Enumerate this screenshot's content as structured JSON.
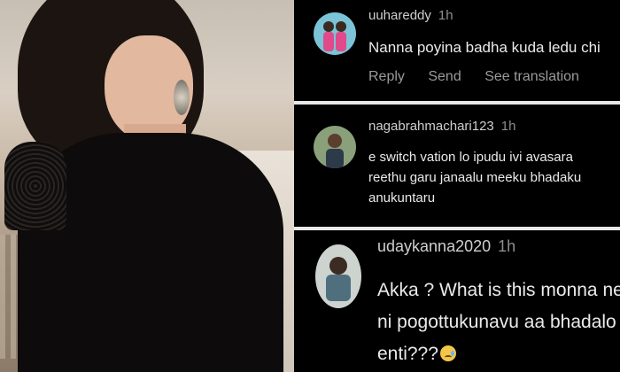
{
  "photo": {
    "alt_subject": "woman-in-black-saree-photo"
  },
  "comments": [
    {
      "username": "uuhareddy",
      "time": "1h",
      "lines": [
        "Nanna poyina badha kuda ledu chi"
      ],
      "actions": {
        "reply": "Reply",
        "send": "Send",
        "translate": "See translation"
      }
    },
    {
      "username": "nagabrahmachari123",
      "time": "1h",
      "lines": [
        "e switch vation lo ipudu ivi avasara",
        "reethu garu janaalu meeku bhadaku",
        "anukuntaru"
      ]
    },
    {
      "username": "udaykanna2020",
      "time": "1h",
      "lines": [
        "Akka ? What is this monna ney",
        "ni pogottukunavu aa bhadalo u",
        "enti???"
      ],
      "trailing_icon": "crying-face-emoji"
    }
  ],
  "colors": {
    "background": "#000000",
    "divider": "#e8e8e8",
    "muted": "#8e8e8e"
  }
}
